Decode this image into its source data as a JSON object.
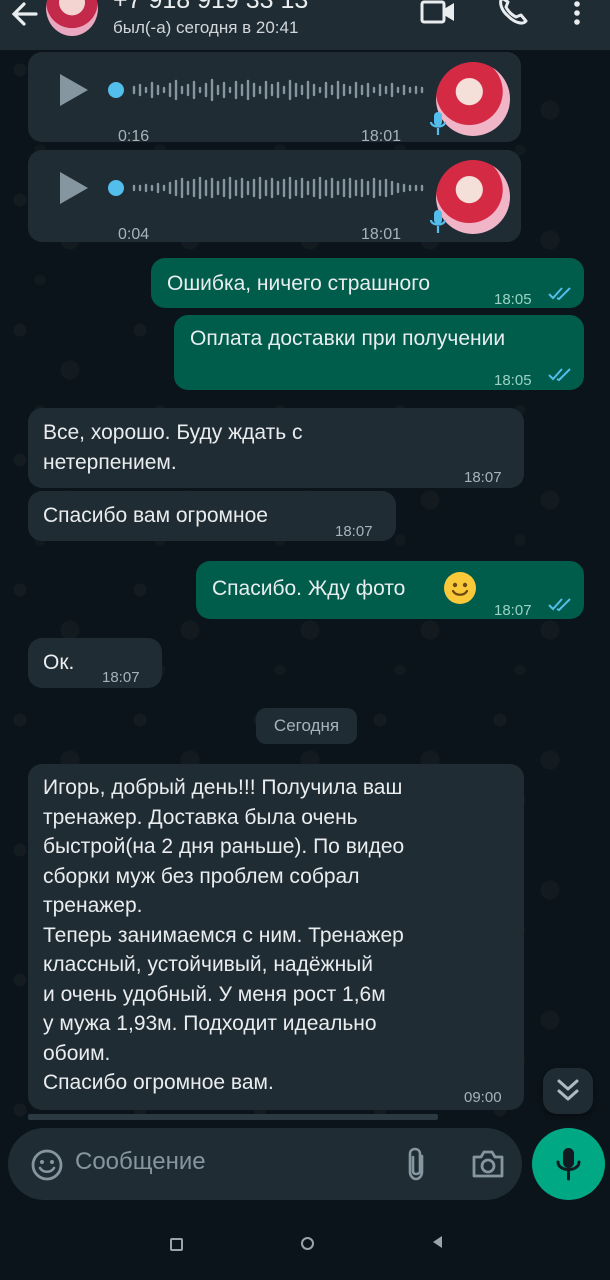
{
  "header": {
    "contact_name": "+7 918 919 33 13",
    "status": "был(-а) сегодня в 20:41"
  },
  "voice_messages": [
    {
      "duration": "0:16",
      "time": "18:01"
    },
    {
      "duration": "0:04",
      "time": "18:01"
    }
  ],
  "messages": [
    {
      "direction": "out",
      "text": "Ошибка, ничего страшного",
      "time": "18:05",
      "status": "read"
    },
    {
      "direction": "out",
      "text": "Оплата доставки при получении",
      "time": "18:05",
      "status": "read"
    },
    {
      "direction": "in",
      "lines": [
        "Все, хорошо. Буду ждать с",
        "нетерпением."
      ],
      "time": "18:07"
    },
    {
      "direction": "in",
      "text": "Спасибо вам огромное",
      "time": "18:07"
    },
    {
      "direction": "out",
      "text": "Спасибо. Жду фото",
      "emoji": "🙂",
      "time": "18:07",
      "status": "read"
    },
    {
      "direction": "in",
      "text": "Ок.",
      "time": "18:07"
    }
  ],
  "date_divider": "Сегодня",
  "long_message": {
    "lines": [
      "Игорь, добрый день!!! Получила ваш",
      "тренажер. Доставка была очень",
      "быстрой(на 2 дня раньше). По видео",
      "сборки муж без проблем собрал",
      "тренажер.",
      "Теперь занимаемся с ним. Тренажер",
      "классный, устойчивый, надёжный",
      "и очень удобный. У меня рост 1,6м",
      "у мужа 1,93м. Подходит идеально",
      "обоим.",
      "Спасибо огромное вам."
    ],
    "time": "09:00"
  },
  "input": {
    "placeholder": "Сообщение"
  },
  "colors": {
    "background": "#0b141a",
    "incoming_bubble": "#202c33",
    "outgoing_bubble": "#005c4b",
    "read_ticks": "#53bdeb",
    "mic_button": "#00a884"
  },
  "icons": [
    "back-arrow-icon",
    "video-call-icon",
    "phone-icon",
    "more-icon",
    "play-icon",
    "mic-icon",
    "emoji-icon",
    "attach-icon",
    "camera-icon",
    "chevron-double-down-icon"
  ]
}
